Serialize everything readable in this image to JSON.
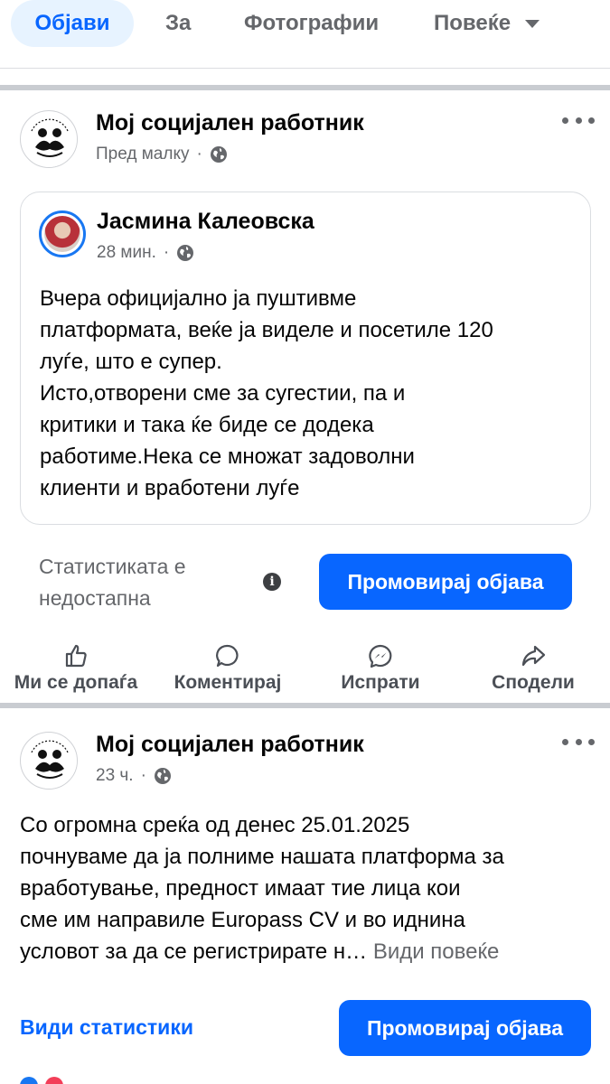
{
  "tabs": [
    {
      "label": "Објави"
    },
    {
      "label": "За"
    },
    {
      "label": "Фотографии"
    },
    {
      "label": "Повеќе"
    }
  ],
  "post1": {
    "page_name": "Мој социјален работник",
    "time": "Пред малку",
    "privacy_icon": "globe-icon",
    "shared": {
      "author": "Јасмина Калеовска",
      "time": "28 мин.",
      "text": "Вчера официјално ја пуштивме\nплатформата, веќе ја виделе и посетиле 120\nлуѓе, што е супер.\nИсто,отворени сме за сугестии, па и\nкритики и така ќе биде се додека\nработиме.Нека се множат задоволни\nклиенти и вработени луѓе"
    },
    "stats_unavailable": "Статистиката е недостапна",
    "promote_label": "Промовирај објава"
  },
  "actions": [
    {
      "label": "Ми се допаѓа",
      "icon": "like-icon"
    },
    {
      "label": "Коментирај",
      "icon": "comment-icon"
    },
    {
      "label": "Испрати",
      "icon": "messenger-icon"
    },
    {
      "label": "Сподели",
      "icon": "share-icon"
    }
  ],
  "post2": {
    "page_name": "Мој социјален работник",
    "time": "23 ч.",
    "text": "Со огромна среќа од денес 25.01.2025\nпочнуваме да ја полниме нашата платформа за\nвработување,  предност имаат тие лица кои\nсме им направиле Europass CV и во иднина\nусловот за да се регистрирате н…",
    "see_more": "Види повеќе",
    "view_stats": "Види статистики",
    "promote_label": "Промовирај објава"
  },
  "colors": {
    "accent": "#0866ff",
    "tab_active_bg": "#e7f3ff",
    "secondary_text": "#65676b"
  }
}
